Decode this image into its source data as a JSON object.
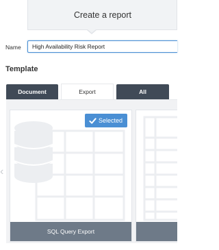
{
  "header": {
    "title": "Create a report"
  },
  "name_field": {
    "label": "Name",
    "value": "High Availability Risk Report"
  },
  "template": {
    "heading": "Template",
    "tabs": [
      {
        "label": "Document",
        "active": false
      },
      {
        "label": "Export",
        "active": true
      },
      {
        "label": "All",
        "active": false
      }
    ]
  },
  "cards": [
    {
      "label": "SQL Query Export",
      "badge": "Selected",
      "selected": true,
      "icon": "database-table-icon"
    },
    {
      "label": "",
      "selected": false,
      "icon": "document-lines-icon"
    }
  ],
  "carousel": {
    "prev_icon": "chevron-left-icon"
  },
  "colors": {
    "accent": "#4a8fd4",
    "tab_dark": "#404a57",
    "card_footer": "#6e7a88",
    "panel_bg": "#f1f2f4"
  }
}
